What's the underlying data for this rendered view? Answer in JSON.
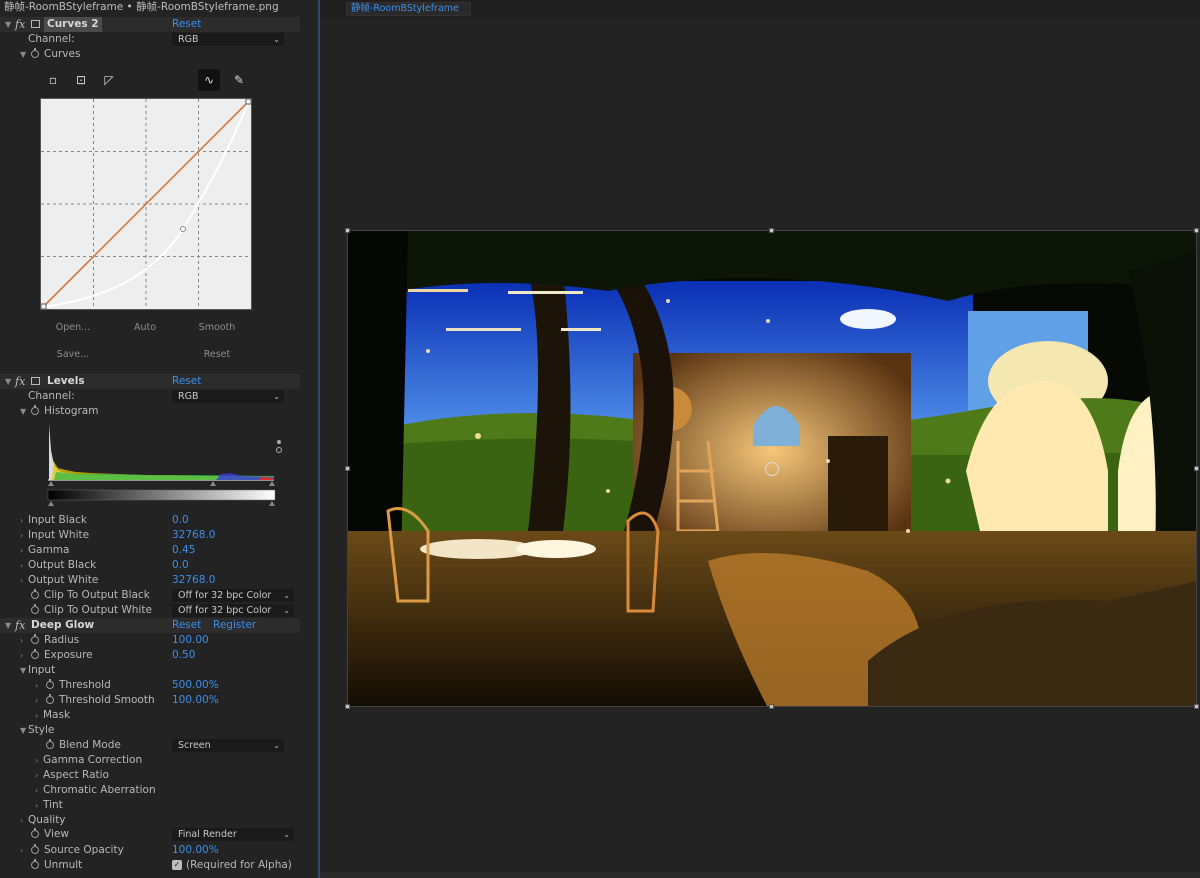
{
  "top_title": "静帧-RoomBStyleframe • 静帧-RoomBStyleframe.png",
  "viewer_tab": "静帧-RoomBStyleframe",
  "curves": {
    "name": "Curves 2",
    "reset": "Reset",
    "channel_label": "Channel:",
    "channel_value": "RGB",
    "curves_label": "Curves",
    "buttons": {
      "open": "Open...",
      "auto": "Auto",
      "smooth": "Smooth",
      "save": "Save...",
      "reset": "Reset"
    }
  },
  "levels": {
    "name": "Levels",
    "reset": "Reset",
    "channel_label": "Channel:",
    "channel_value": "RGB",
    "histogram_label": "Histogram",
    "params": [
      {
        "label": "Input Black",
        "value": "0.0"
      },
      {
        "label": "Input White",
        "value": "32768.0"
      },
      {
        "label": "Gamma",
        "value": "0.45"
      },
      {
        "label": "Output Black",
        "value": "0.0"
      },
      {
        "label": "Output White",
        "value": "32768.0"
      }
    ],
    "clip_black_label": "Clip To Output Black",
    "clip_black_value": "Off for 32 bpc Color",
    "clip_white_label": "Clip To Output White",
    "clip_white_value": "Off for 32 bpc Color"
  },
  "deep_glow": {
    "name": "Deep Glow",
    "reset": "Reset",
    "register": "Register",
    "radius_label": "Radius",
    "radius_value": "100.00",
    "exposure_label": "Exposure",
    "exposure_value": "0.50",
    "input_label": "Input",
    "threshold_label": "Threshold",
    "threshold_value": "500.00%",
    "threshold_smooth_label": "Threshold Smooth",
    "threshold_smooth_value": "100.00%",
    "mask_label": "Mask",
    "style_label": "Style",
    "blend_mode_label": "Blend Mode",
    "blend_mode_value": "Screen",
    "gamma_correction_label": "Gamma Correction",
    "aspect_ratio_label": "Aspect Ratio",
    "chromatic_aberration_label": "Chromatic Aberration",
    "tint_label": "Tint",
    "quality_label": "Quality",
    "view_label": "View",
    "view_value": "Final Render",
    "source_opacity_label": "Source Opacity",
    "source_opacity_value": "100.00%",
    "unmult_label": "Unmult",
    "unmult_checked": true,
    "unmult_note": "(Required for Alpha)"
  },
  "colors": {
    "accent_blue": "#3d8eea",
    "panel_bg": "#232323",
    "curve_line": "#d07a3e"
  }
}
